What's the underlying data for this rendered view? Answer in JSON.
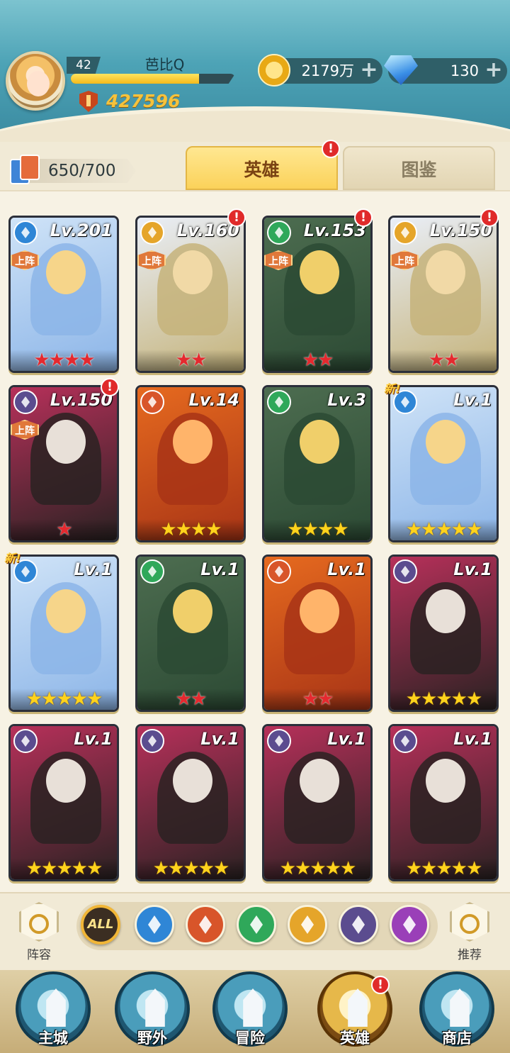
{
  "player": {
    "level": "42",
    "name": "芭比Q",
    "exp_progress": 0.78,
    "power": "427596"
  },
  "currencies": {
    "gold": "2179万",
    "gems": "130"
  },
  "tabs": {
    "card_count": "650/700",
    "heroes": "英雄",
    "codex": "图鉴"
  },
  "badges": {
    "alert": "!",
    "new": "新!",
    "deploy": "上阵"
  },
  "heroes": [
    {
      "level": "Lv.201",
      "element": "water",
      "deployed": true,
      "stars": "★★★★",
      "star_color": "red",
      "alert": false,
      "new": false
    },
    {
      "level": "Lv.160",
      "element": "light",
      "deployed": true,
      "stars": "★★",
      "star_color": "red",
      "alert": true,
      "new": false
    },
    {
      "level": "Lv.153",
      "element": "wind",
      "deployed": true,
      "stars": "★★",
      "star_color": "red",
      "alert": true,
      "new": false
    },
    {
      "level": "Lv.150",
      "element": "light",
      "deployed": true,
      "stars": "★★",
      "star_color": "red",
      "alert": true,
      "new": false
    },
    {
      "level": "Lv.150",
      "element": "dark",
      "deployed": true,
      "stars": "★",
      "star_color": "red",
      "alert": true,
      "new": false
    },
    {
      "level": "Lv.14",
      "element": "fire",
      "deployed": false,
      "stars": "★★★★",
      "star_color": "gold",
      "alert": false,
      "new": false
    },
    {
      "level": "Lv.3",
      "element": "wind",
      "deployed": false,
      "stars": "★★★★",
      "star_color": "gold",
      "alert": false,
      "new": false
    },
    {
      "level": "Lv.1",
      "element": "water",
      "deployed": false,
      "stars": "★★★★★",
      "star_color": "gold",
      "alert": false,
      "new": true
    },
    {
      "level": "Lv.1",
      "element": "water",
      "deployed": false,
      "stars": "★★★★★",
      "star_color": "gold",
      "alert": false,
      "new": true
    },
    {
      "level": "Lv.1",
      "element": "wind",
      "deployed": false,
      "stars": "★★",
      "star_color": "red",
      "alert": false,
      "new": false
    },
    {
      "level": "Lv.1",
      "element": "fire",
      "deployed": false,
      "stars": "★★",
      "star_color": "red",
      "alert": false,
      "new": false
    },
    {
      "level": "Lv.1",
      "element": "dark",
      "deployed": false,
      "stars": "★★★★★",
      "star_color": "gold",
      "alert": false,
      "new": false
    },
    {
      "level": "Lv.1",
      "element": "dark",
      "deployed": false,
      "stars": "★★★★★",
      "star_color": "gold",
      "alert": false,
      "new": false
    },
    {
      "level": "Lv.1",
      "element": "dark",
      "deployed": false,
      "stars": "★★★★★",
      "star_color": "gold",
      "alert": false,
      "new": false
    },
    {
      "level": "Lv.1",
      "element": "dark",
      "deployed": false,
      "stars": "★★★★★",
      "star_color": "gold",
      "alert": false,
      "new": false
    },
    {
      "level": "Lv.1",
      "element": "dark",
      "deployed": false,
      "stars": "★★★★★",
      "star_color": "gold",
      "alert": false,
      "new": false
    }
  ],
  "element_colors": {
    "water": "#2f86d6",
    "light": "#e5a52a",
    "wind": "#2fa85a",
    "dark": "#5b4c8f",
    "fire": "#d8552a",
    "arcane": "#9a3fb8"
  },
  "filters": {
    "lineup": "阵容",
    "all": "ALL",
    "elements": [
      "water",
      "fire",
      "wind",
      "light",
      "dark",
      "arcane"
    ],
    "recommend": "推荐"
  },
  "nav": {
    "main_city": "主城",
    "wild": "野外",
    "adventure": "冒险",
    "heroes": "英雄",
    "shop": "商店"
  }
}
